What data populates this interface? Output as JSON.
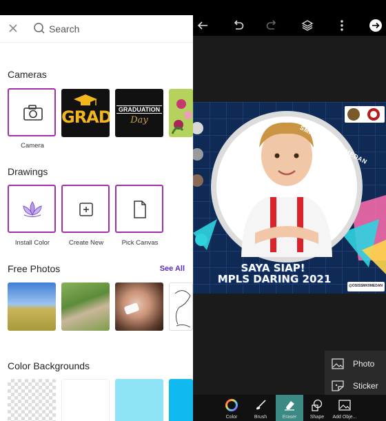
{
  "search": {
    "label": "Search"
  },
  "sections": {
    "cameras": "Cameras",
    "drawings": "Drawings",
    "free_photos": "Free Photos",
    "see_all": "See All",
    "color_backgrounds": "Color Backgrounds"
  },
  "cameras": {
    "camera_label": "Camera",
    "grad_text": "GRAD",
    "graduation_text": "GRADUATION",
    "graduation_sub": "Day"
  },
  "drawings": {
    "install_color": "Install Color",
    "create_new": "Create New",
    "pick_canvas": "Pick Canvas"
  },
  "canvas": {
    "school_text": "SMK NEGERI 9 MEDAN",
    "line1": "SAYA SIAP!",
    "line2": "MPLS DARING 2021",
    "handle": "@OSISSMK9MEDAN"
  },
  "popup": {
    "photo": "Photo",
    "sticker": "Sticker"
  },
  "tools": {
    "color": "Color",
    "brush": "Brush",
    "eraser": "Eraser",
    "shape": "Shape",
    "add_object": "Add Obje..."
  },
  "colors": {
    "accent": "#a42ea8",
    "link": "#5b2bb5",
    "active_tool": "#3c8a84"
  }
}
